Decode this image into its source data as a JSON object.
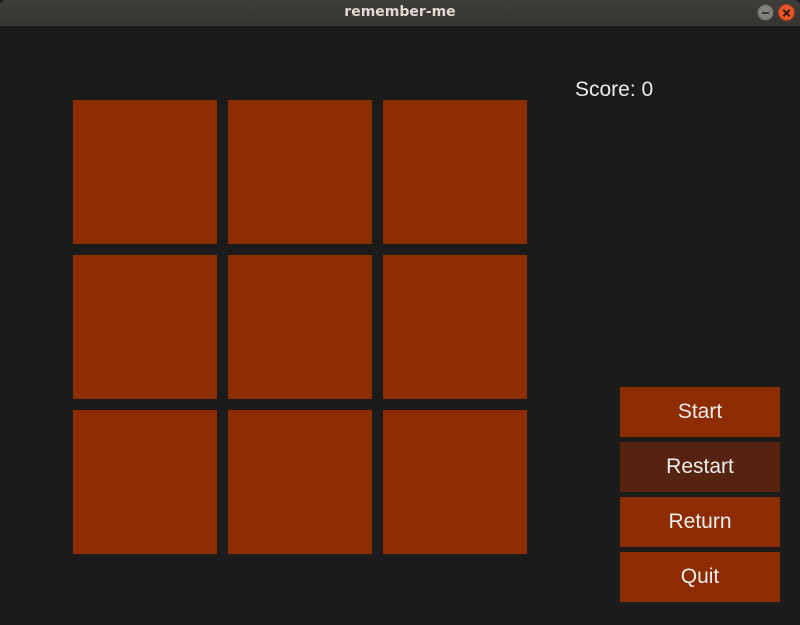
{
  "window": {
    "title": "remember-me"
  },
  "game": {
    "score_text": "Score: 0",
    "tiles": [
      "",
      "",
      "",
      "",
      "",
      "",
      "",
      "",
      ""
    ]
  },
  "menu": {
    "start_label": "Start",
    "restart_label": "Restart",
    "return_label": "Return",
    "quit_label": "Quit",
    "highlighted": "restart"
  },
  "colors": {
    "background": "#1b1b1b",
    "tile": "#8c2c00",
    "button": "#8c2c00",
    "button_highlight": "#552310",
    "text": "#ebebeb"
  }
}
